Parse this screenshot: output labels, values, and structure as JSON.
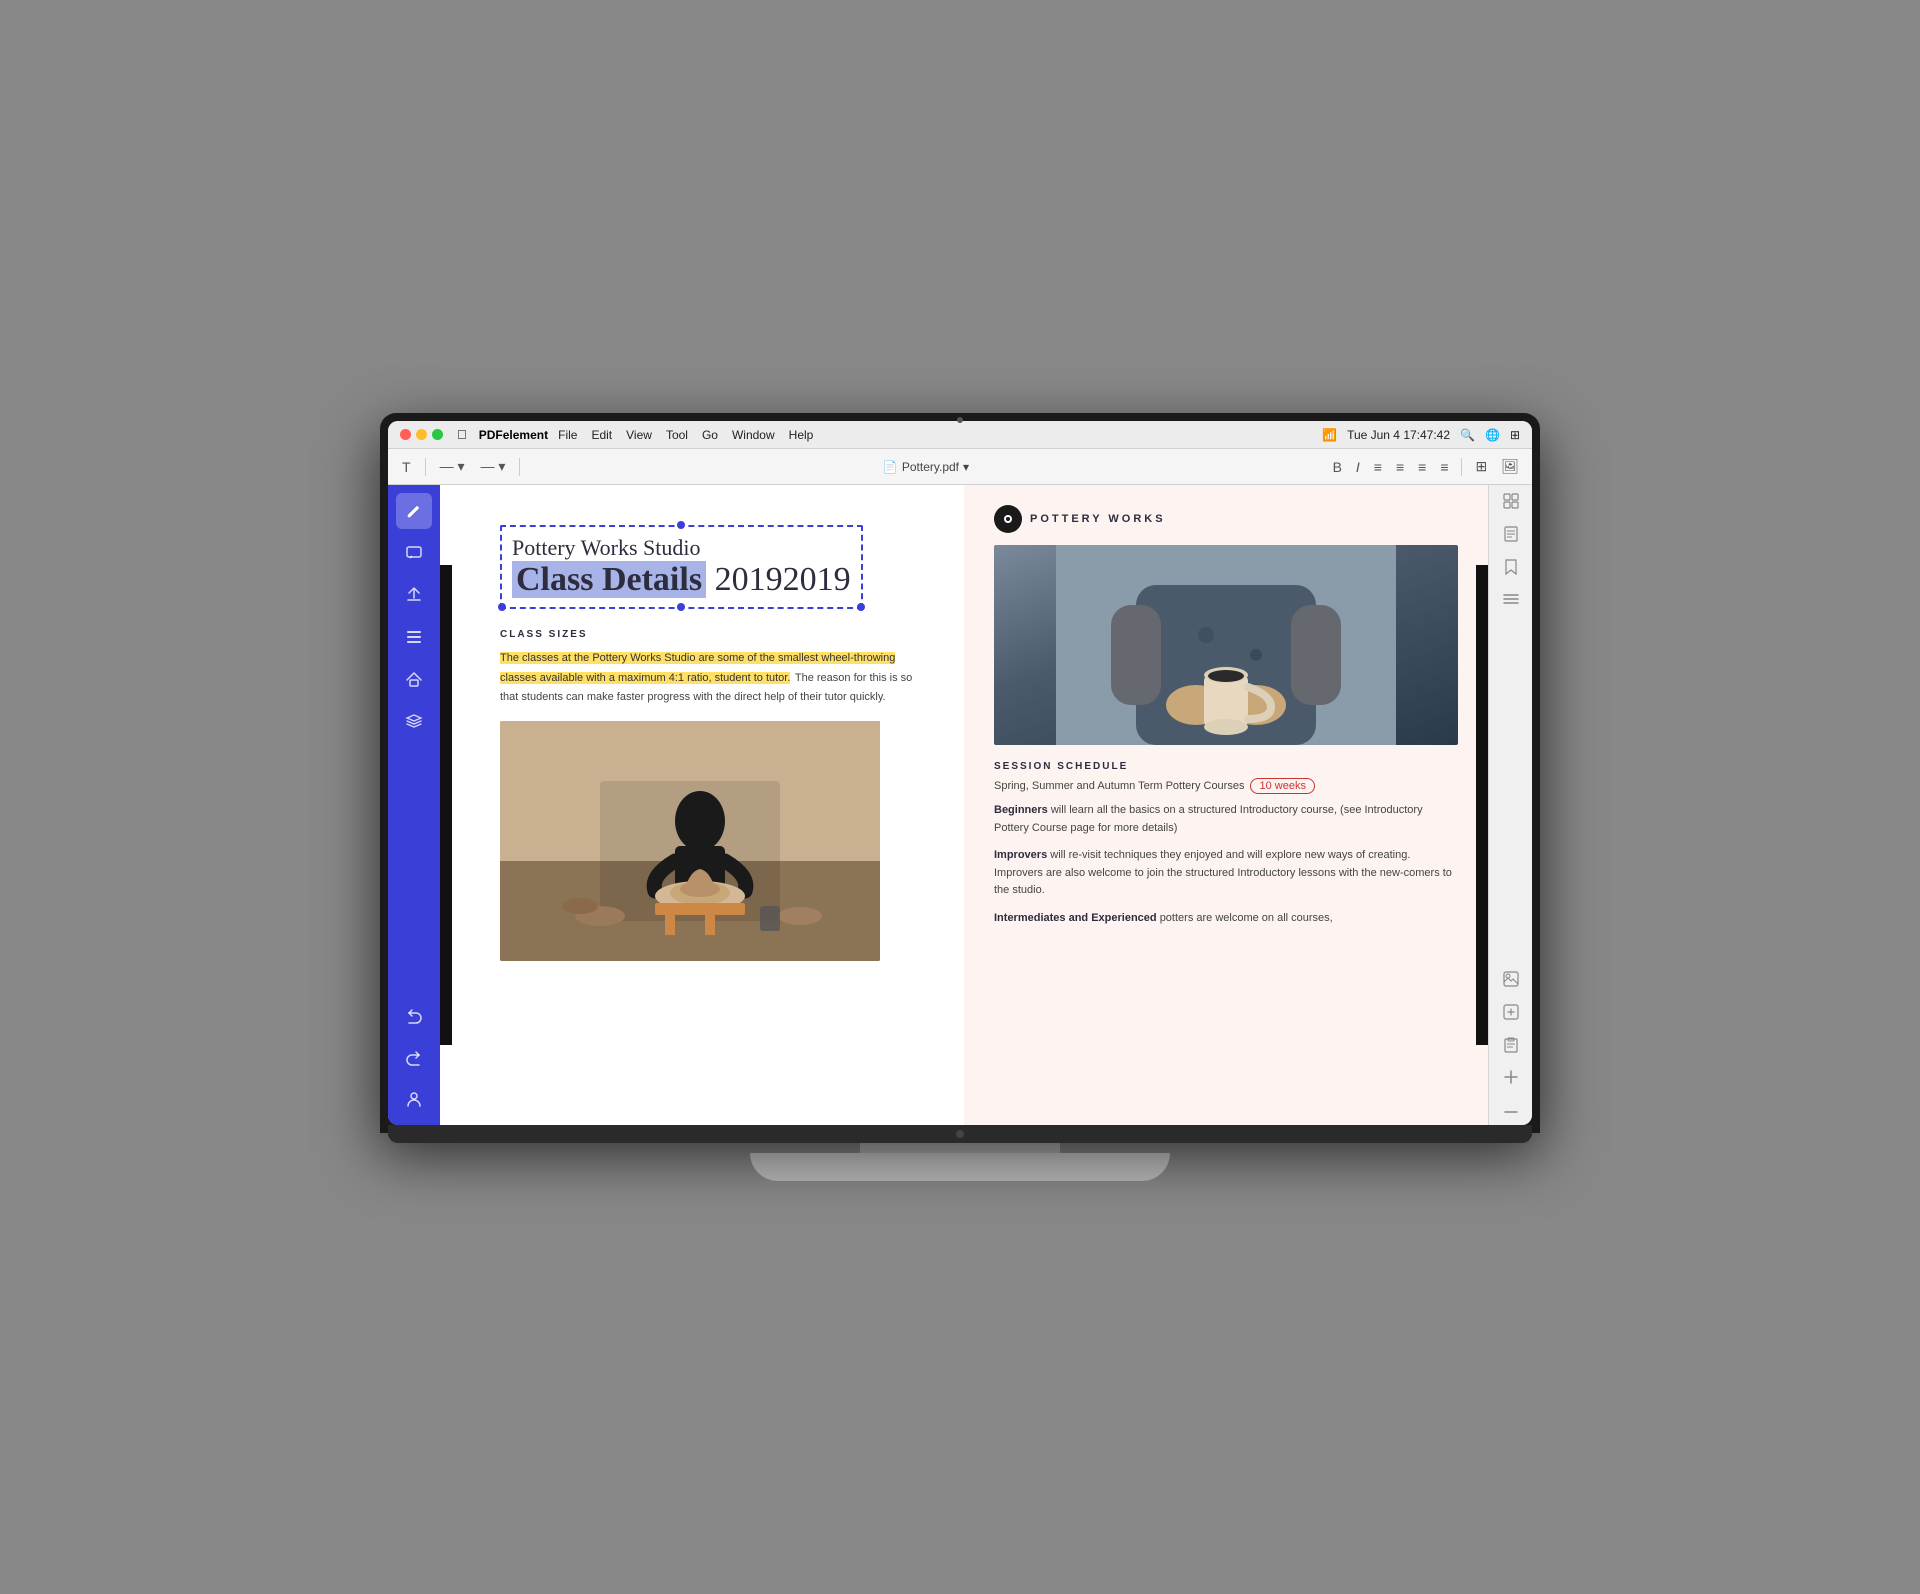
{
  "menubar": {
    "app_name": "PDFelement",
    "menus": [
      "File",
      "Edit",
      "View",
      "Tool",
      "Go",
      "Window",
      "Help"
    ],
    "time": "Tue Jun 4  17:47:42",
    "pdf_title": "Pottery.pdf"
  },
  "toolbar": {
    "text_tool": "T",
    "font_placeholder": "—",
    "size_placeholder": "—",
    "separator": "|"
  },
  "left_sidebar": {
    "icons": [
      {
        "name": "pencil-icon",
        "symbol": "✏️",
        "active": true
      },
      {
        "name": "comment-icon",
        "symbol": "💬",
        "active": false
      },
      {
        "name": "share-icon",
        "symbol": "✈",
        "active": false
      },
      {
        "name": "list-icon",
        "symbol": "☰",
        "active": false
      },
      {
        "name": "home-icon",
        "symbol": "⌂",
        "active": false
      },
      {
        "name": "layers-icon",
        "symbol": "⧉",
        "active": false
      }
    ],
    "bottom_icons": [
      {
        "name": "undo-icon",
        "symbol": "↩"
      },
      {
        "name": "redo-icon",
        "symbol": "↪"
      },
      {
        "name": "user-icon",
        "symbol": "👤"
      }
    ]
  },
  "pdf_left": {
    "title_line1": "Pottery Works Studio",
    "title_line2_highlighted": "Class Details",
    "title_year": "2019",
    "class_sizes_heading": "CLASS SIZES",
    "class_sizes_highlighted": "The classes at the Pottery Works Studio are some of the smallest wheel-throwing classes available with a maximum 4:1 ratio, student to tutor.",
    "class_sizes_normal": " The reason for this is so that students can make faster progress with the direct help of their tutor quickly."
  },
  "pdf_right": {
    "brand": "POTTERY WORKS",
    "session_heading": "SESSION SCHEDULE",
    "session_line": "Spring, Summer and Autumn Term Pottery Courses",
    "circled_text": "10 weeks",
    "beginners_label": "Beginners",
    "beginners_text": " will learn all the basics on a structured Introductory course, (see Introductory Pottery Course page for more details)",
    "improvers_label": "Improvers",
    "improvers_text": " will re-visit techniques they enjoyed and will explore new ways of creating. Improvers are also welcome to join the structured Introductory lessons with the new-comers to the studio.",
    "intermediates_label": "Intermediates and Experienced",
    "intermediates_text": " potters are welcome on all courses,"
  },
  "right_sidebar": {
    "icons": [
      {
        "name": "grid-icon",
        "symbol": "⊞"
      },
      {
        "name": "page-icon",
        "symbol": "📄"
      },
      {
        "name": "bookmark-icon",
        "symbol": "🔖"
      },
      {
        "name": "menu-lines-icon",
        "symbol": "≡"
      },
      {
        "name": "image-icon",
        "symbol": "🖼"
      },
      {
        "name": "image2-icon",
        "symbol": "🗂"
      },
      {
        "name": "image3-icon",
        "symbol": "📋"
      },
      {
        "name": "add-icon",
        "symbol": "+"
      },
      {
        "name": "minus-icon",
        "symbol": "−"
      }
    ]
  }
}
